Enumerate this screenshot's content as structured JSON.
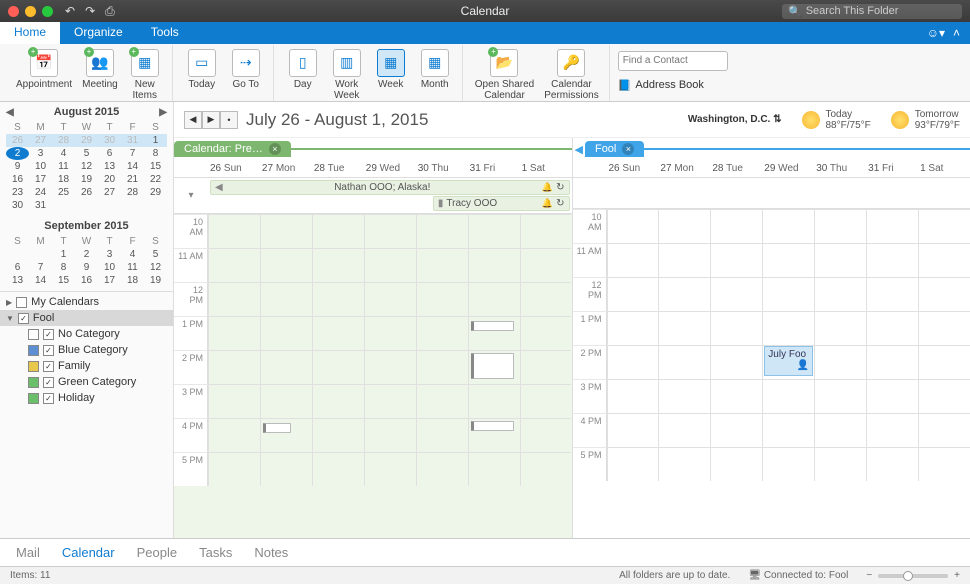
{
  "window": {
    "title": "Calendar"
  },
  "search": {
    "placeholder": "Search This Folder"
  },
  "tabs": {
    "items": [
      "Home",
      "Organize",
      "Tools"
    ],
    "active": 0
  },
  "ribbon": {
    "new": {
      "appointment": "Appointment",
      "meeting": "Meeting",
      "newitems": "New\nItems"
    },
    "goto": {
      "today": "Today",
      "goto": "Go To"
    },
    "view": {
      "day": "Day",
      "workweek": "Work\nWeek",
      "week": "Week",
      "month": "Month"
    },
    "share": {
      "openshared": "Open Shared\nCalendar",
      "perms": "Calendar\nPermissions"
    },
    "find": {
      "contact_placeholder": "Find a Contact",
      "addressbook": "Address Book"
    }
  },
  "minical1": {
    "title": "August 2015",
    "dow": [
      "S",
      "M",
      "T",
      "W",
      "T",
      "F",
      "S"
    ],
    "rows": [
      [
        {
          "d": "26",
          "dim": true,
          "hl": true
        },
        {
          "d": "27",
          "dim": true,
          "hl": true
        },
        {
          "d": "28",
          "dim": true,
          "hl": true
        },
        {
          "d": "29",
          "dim": true,
          "hl": true
        },
        {
          "d": "30",
          "dim": true,
          "hl": true
        },
        {
          "d": "31",
          "dim": true,
          "hl": true
        },
        {
          "d": "1",
          "hl": true
        }
      ],
      [
        {
          "d": "2",
          "sel": true
        },
        {
          "d": "3"
        },
        {
          "d": "4"
        },
        {
          "d": "5"
        },
        {
          "d": "6"
        },
        {
          "d": "7"
        },
        {
          "d": "8"
        }
      ],
      [
        {
          "d": "9"
        },
        {
          "d": "10"
        },
        {
          "d": "11"
        },
        {
          "d": "12"
        },
        {
          "d": "13"
        },
        {
          "d": "14"
        },
        {
          "d": "15"
        }
      ],
      [
        {
          "d": "16"
        },
        {
          "d": "17"
        },
        {
          "d": "18"
        },
        {
          "d": "19"
        },
        {
          "d": "20"
        },
        {
          "d": "21"
        },
        {
          "d": "22"
        }
      ],
      [
        {
          "d": "23"
        },
        {
          "d": "24"
        },
        {
          "d": "25"
        },
        {
          "d": "26"
        },
        {
          "d": "27"
        },
        {
          "d": "28"
        },
        {
          "d": "29"
        }
      ],
      [
        {
          "d": "30"
        },
        {
          "d": "31"
        },
        {
          "d": ""
        },
        {
          "d": ""
        },
        {
          "d": ""
        },
        {
          "d": ""
        },
        {
          "d": ""
        }
      ]
    ]
  },
  "minical2": {
    "title": "September 2015",
    "dow": [
      "S",
      "M",
      "T",
      "W",
      "T",
      "F",
      "S"
    ],
    "rows": [
      [
        {
          "d": ""
        },
        {
          "d": ""
        },
        {
          "d": "1"
        },
        {
          "d": "2"
        },
        {
          "d": "3"
        },
        {
          "d": "4"
        },
        {
          "d": "5"
        }
      ],
      [
        {
          "d": "6"
        },
        {
          "d": "7"
        },
        {
          "d": "8"
        },
        {
          "d": "9"
        },
        {
          "d": "10"
        },
        {
          "d": "11"
        },
        {
          "d": "12"
        }
      ],
      [
        {
          "d": "13"
        },
        {
          "d": "14"
        },
        {
          "d": "15"
        },
        {
          "d": "16"
        },
        {
          "d": "17"
        },
        {
          "d": "18"
        },
        {
          "d": "19"
        }
      ]
    ]
  },
  "callist": {
    "mycals": "My Calendars",
    "fool": "Fool",
    "cats": [
      {
        "label": "No Category",
        "color": "#fff"
      },
      {
        "label": "Blue Category",
        "color": "#5b8fd1"
      },
      {
        "label": "Family",
        "color": "#e8c84b"
      },
      {
        "label": "Green Category",
        "color": "#6bbf6b"
      },
      {
        "label": "Holiday",
        "color": "#6bbf6b"
      }
    ]
  },
  "range": {
    "title": "July 26 - August 1, 2015"
  },
  "weather": {
    "loc": "Washington,  D.C.",
    "today_label": "Today",
    "today_temp": "88°F/75°F",
    "tom_label": "Tomorrow",
    "tom_temp": "93°F/79°F"
  },
  "panels": {
    "left": {
      "tab": "Calendar: Pre…",
      "days": [
        [
          "26",
          "Sun"
        ],
        [
          "27",
          "Mon"
        ],
        [
          "28",
          "Tue"
        ],
        [
          "29",
          "Wed"
        ],
        [
          "30",
          "Thu"
        ],
        [
          "31",
          "Fri"
        ],
        [
          "1",
          "Sat"
        ]
      ]
    },
    "right": {
      "tab": "Fool",
      "days": [
        [
          "26",
          "Sun"
        ],
        [
          "27",
          "Mon"
        ],
        [
          "28",
          "Tue"
        ],
        [
          "29",
          "Wed"
        ],
        [
          "30",
          "Thu"
        ],
        [
          "31",
          "Fri"
        ],
        [
          "1",
          "Sat"
        ]
      ]
    }
  },
  "allday": {
    "ev1": "Nathan OOO; Alaska!",
    "ev2": "Tracy OOO"
  },
  "hours": [
    "10 AM",
    "11 AM",
    "12 PM",
    "1 PM",
    "2 PM",
    "3 PM",
    "4 PM",
    "5 PM"
  ],
  "right_event": "July Foo",
  "bottomnav": [
    "Mail",
    "Calendar",
    "People",
    "Tasks",
    "Notes"
  ],
  "status": {
    "items": "Items: 11",
    "uptodate": "All folders are up to date.",
    "connected": "Connected to: Fool"
  }
}
